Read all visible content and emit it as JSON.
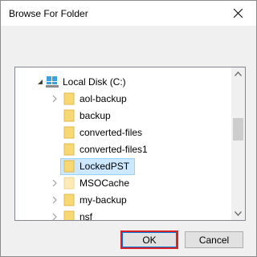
{
  "window": {
    "title": "Browse For Folder"
  },
  "tree": {
    "items": [
      {
        "label": "Local Disk (C:)",
        "icon": "drive-icon",
        "expander": "expanded"
      },
      {
        "label": "aol-backup",
        "icon": "folder-icon",
        "expander": "collapsed"
      },
      {
        "label": "backup",
        "icon": "folder-icon",
        "expander": "none"
      },
      {
        "label": "converted-files",
        "icon": "folder-icon",
        "expander": "none"
      },
      {
        "label": "converted-files1",
        "icon": "folder-icon",
        "expander": "none"
      },
      {
        "label": "LockedPST",
        "icon": "folder-icon",
        "expander": "none",
        "selected": true
      },
      {
        "label": "MSOCache",
        "icon": "folder-icon-faded",
        "expander": "collapsed"
      },
      {
        "label": "my-backup",
        "icon": "folder-icon",
        "expander": "collapsed"
      },
      {
        "label": "nsf",
        "icon": "folder-icon",
        "expander": "collapsed"
      }
    ]
  },
  "buttons": {
    "ok_label": "OK",
    "cancel_label": "Cancel"
  },
  "colors": {
    "folder": "#f8d775",
    "selection": "#cce8ff",
    "ok_highlight": "#d81f26"
  }
}
